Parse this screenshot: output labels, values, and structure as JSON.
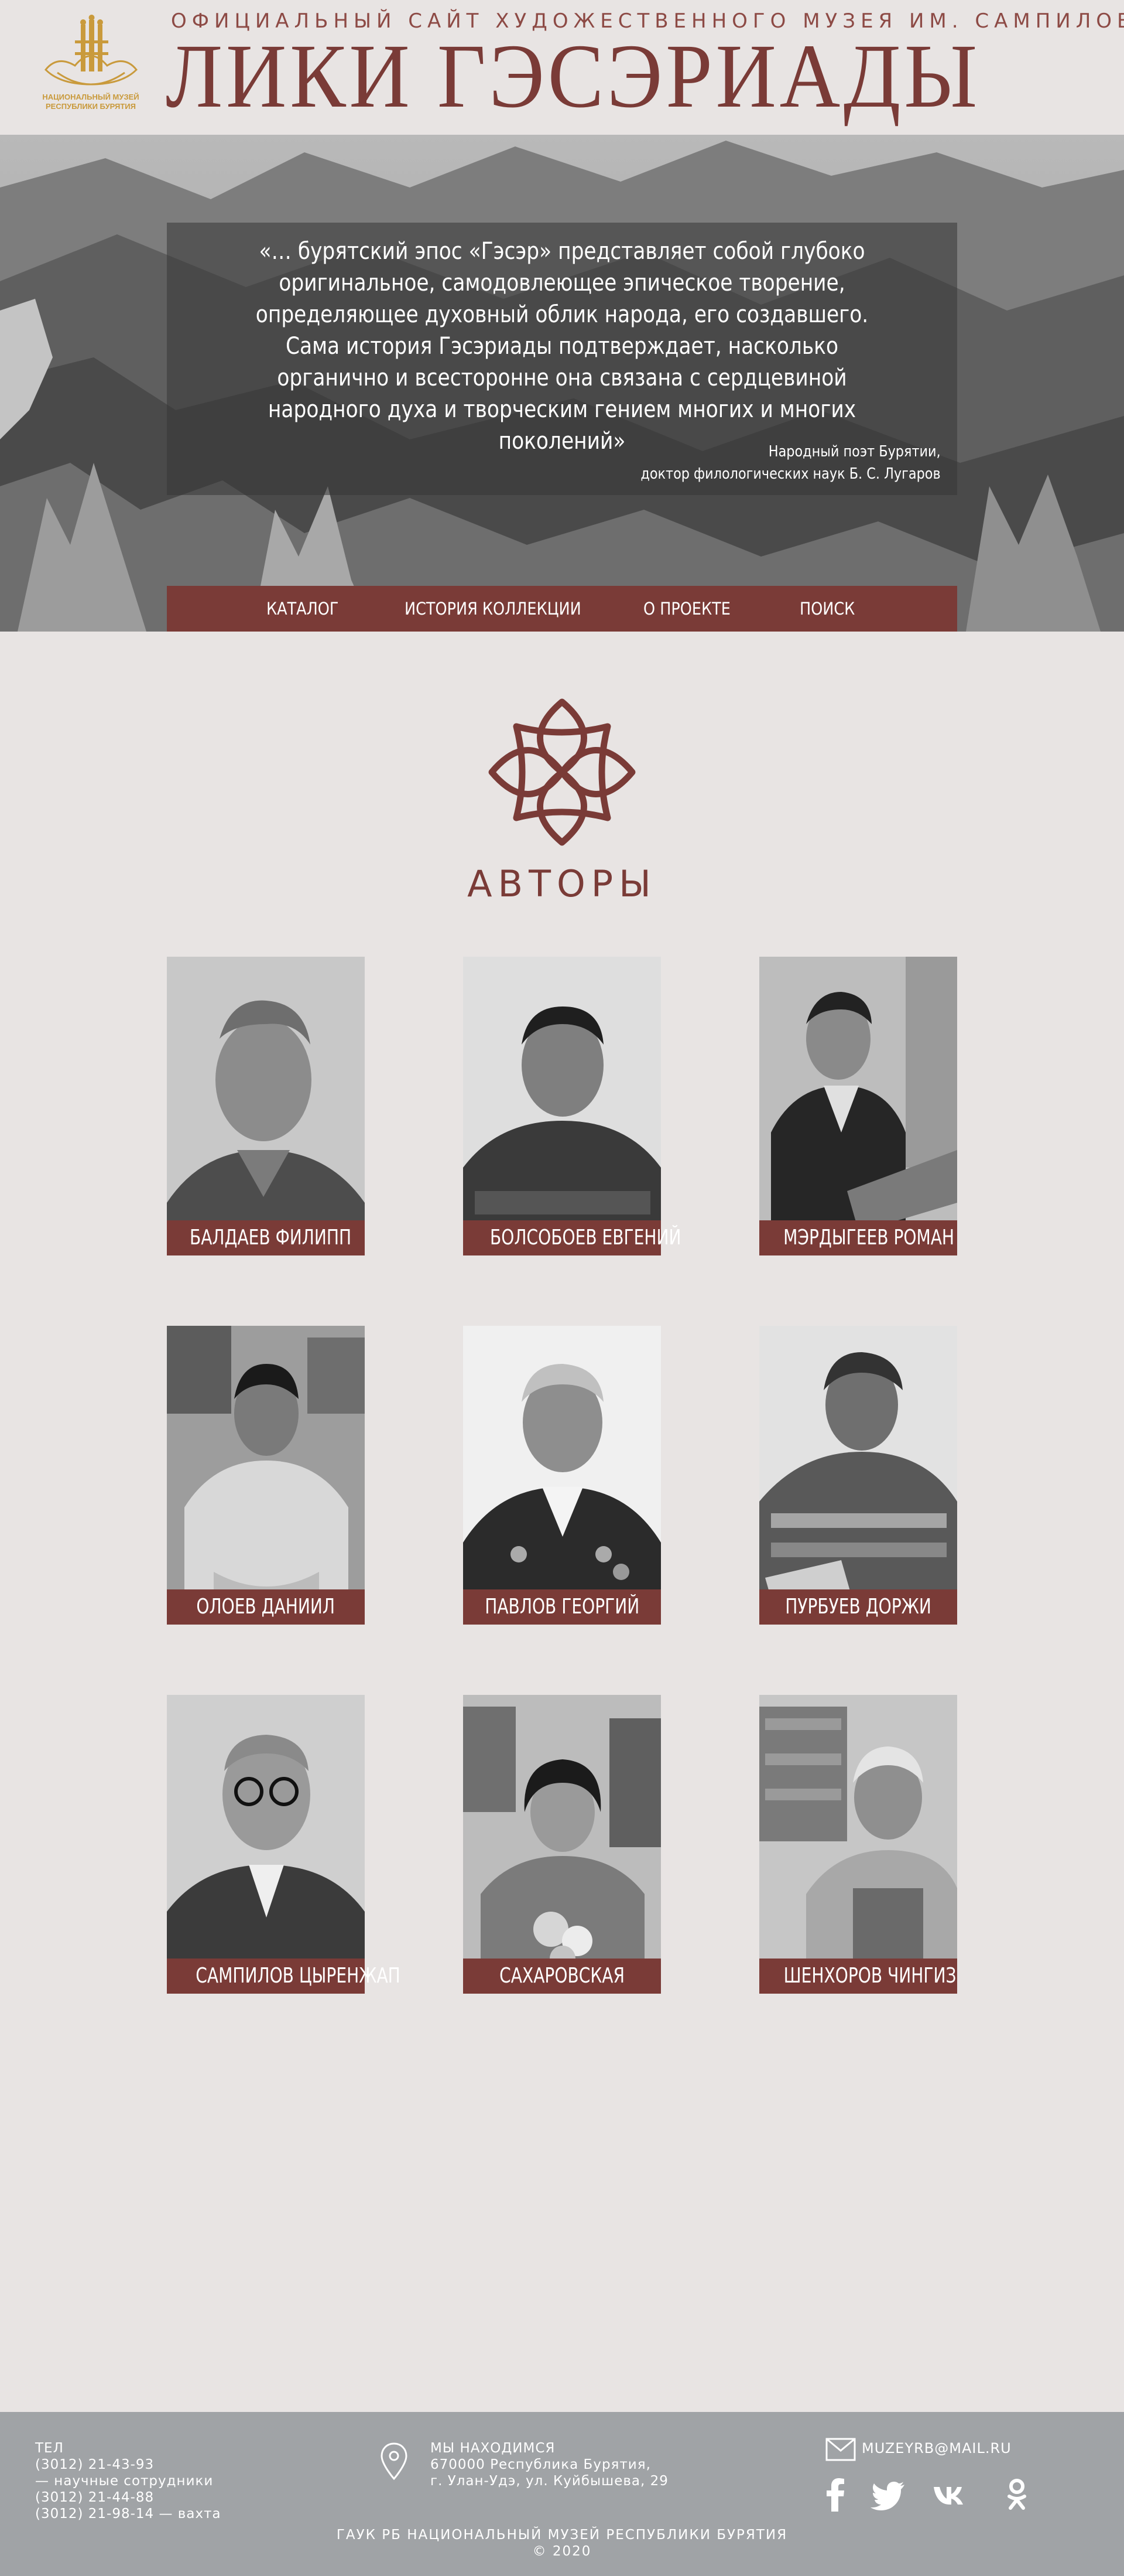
{
  "header": {
    "subtitle": "ОФИЦИАЛЬНЫЙ САЙТ ХУДОЖЕСТВЕННОГО МУЗЕЯ ИМ. САМПИЛОВА",
    "title": "ЛИКИ ГЭСЭРИАДЫ",
    "logo_text": [
      "НАЦИОНАЛЬНЫЙ МУЗЕЙ",
      "РЕСПУБЛИКИ БУРЯТИЯ"
    ],
    "logo_color": "#c99a3c"
  },
  "hero": {
    "quote": "«… бурятский эпос «Гэсэр» представляет собой глубоко оригинальное, самодовлеющее эпическое творение, определяющее духовный облик народа, его создавшего. Сама история Гэсэриады подтверждает, насколько органично и всесторонне она связана с сердцевиной народного духа и творческим гением многих и многих поколений»",
    "author_line1": "Народный поэт Бурятии,",
    "author_line2": "доктор филологических наук Б. С. Лугаров"
  },
  "nav": {
    "catalog": "КАТАЛОГ",
    "history": "ИСТОРИЯ КОЛЛЕКЦИИ",
    "about": "О ПРОЕКТЕ",
    "search": "ПОИСК"
  },
  "authors": {
    "title": "АВТОРЫ",
    "items": [
      {
        "name": "БАЛДАЕВ ФИЛИПП"
      },
      {
        "name": "БОЛСОБОЕВ ЕВГЕНИЙ"
      },
      {
        "name": "МЭРДЫГЕЕВ РОМАН"
      },
      {
        "name": "ОЛОЕВ ДАНИИЛ"
      },
      {
        "name": "ПАВЛОВ ГЕОРГИЙ"
      },
      {
        "name": "ПУРБУЕВ ДОРЖИ"
      },
      {
        "name": "САМПИЛОВ ЦЫРЕНЖАП"
      },
      {
        "name": "САХАРОВСКАЯ"
      },
      {
        "name": "ШЕНХОРОВ ЧИНГИЗ"
      }
    ]
  },
  "footer": {
    "tel_label": "ТЕЛ",
    "phone1": "(3012) 21-43-93",
    "phone1_note": "— научные сотрудники",
    "phone2": "(3012) 21-44-88",
    "phone3": "(3012) 21-98-14 — вахта",
    "address_label": "МЫ НАХОДИМСЯ",
    "address_line1": "670000 Республика Бурятия,",
    "address_line2": "г. Улан-Удэ, ул. Куйбышева, 29",
    "email": "MUZEYRB@MAIL.RU",
    "org": "ГАУК РБ НАЦИОНАЛЬНЫЙ МУЗЕЙ РЕСПУБЛИКИ БУРЯТИЯ",
    "copyright": "© 2020",
    "social": [
      "facebook-icon",
      "twitter-icon",
      "vk-icon",
      "odnoklassniki-icon"
    ]
  },
  "colors": {
    "accent": "#7a3b37",
    "background": "#e8e4e3",
    "footer": "#a0a3a6",
    "logo": "#c99a3c"
  }
}
